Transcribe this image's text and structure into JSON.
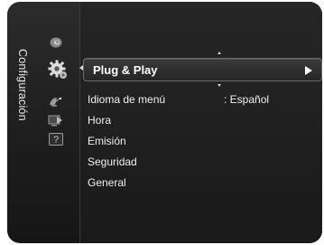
{
  "menu": {
    "title": "Configuración",
    "icons": [
      "picture-icon",
      "settings-gear-icon",
      "satellite-dish-icon",
      "input-icon",
      "help-icon"
    ],
    "selected_item": {
      "label": "Plug & Play"
    },
    "items": [
      {
        "label": "Idioma de menú",
        "value": ": Español"
      },
      {
        "label": "Hora"
      },
      {
        "label": "Emisión"
      },
      {
        "label": "Seguridad"
      },
      {
        "label": "General"
      }
    ]
  }
}
